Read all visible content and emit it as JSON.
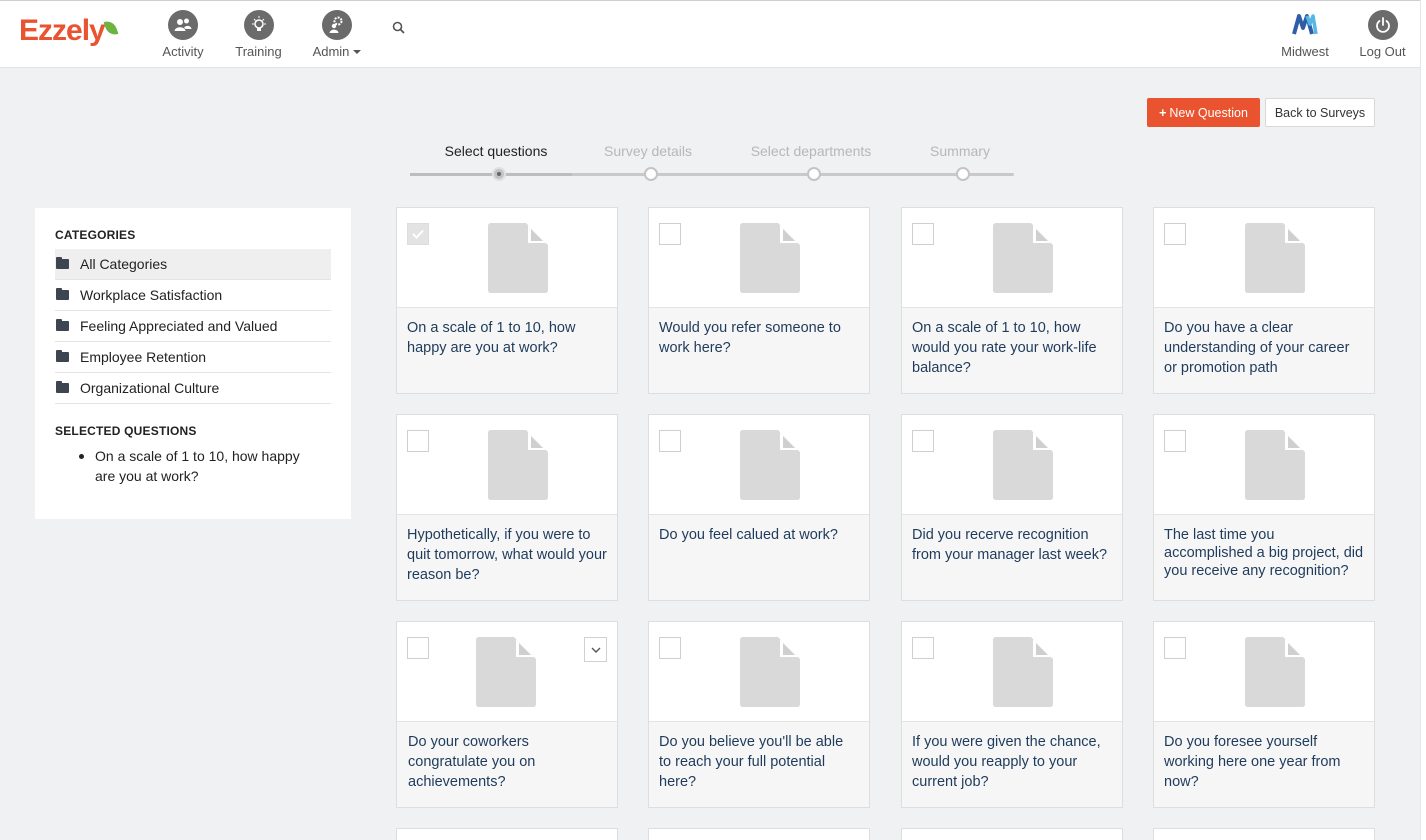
{
  "brand": {
    "logo_text": "Ezzely",
    "accent_color": "#e9532f"
  },
  "nav": {
    "items": [
      {
        "label": "Activity",
        "icon": "people-icon"
      },
      {
        "label": "Training",
        "icon": "lightbulb-icon"
      },
      {
        "label": "Admin",
        "icon": "admin-gear-icon"
      }
    ],
    "search_icon": "search-icon",
    "org": {
      "label": "Midwest",
      "icon": "midwest-logo-icon"
    },
    "logout": {
      "label": "Log Out",
      "icon": "power-icon"
    }
  },
  "actions": {
    "new_question": "New Question",
    "back_to_surveys": "Back to Surveys"
  },
  "stepper": {
    "steps": [
      "Select questions",
      "Survey details",
      "Select departments",
      "Summary"
    ],
    "active_index": 0
  },
  "sidebar": {
    "categories_heading": "CATEGORIES",
    "categories": [
      "All Categories",
      "Workplace Satisfaction",
      "Feeling Appreciated and Valued",
      "Employee Retention",
      "Organizational Culture"
    ],
    "active_category": 0,
    "selected_heading": "SELECTED QUESTIONS",
    "selected": [
      "On a scale of 1 to 10, how happy are you at work?"
    ]
  },
  "questions": [
    {
      "text": "On a scale of 1 to 10, how happy are you at work?",
      "checked": true
    },
    {
      "text": "Would you refer someone to work here?",
      "checked": false
    },
    {
      "text": "On a scale of 1 to 10, how would you rate your work-life balance?",
      "checked": false
    },
    {
      "text": "Do you have a clear understanding of your career or promotion path",
      "checked": false
    },
    {
      "text": "Hypothetically, if you were to quit tomorrow, what would your reason be?",
      "checked": false
    },
    {
      "text": "Do you feel calued at work?",
      "checked": false
    },
    {
      "text": "Did you recerve recognition from your manager last week?",
      "checked": false
    },
    {
      "text": "The last time you accomplished a big project, did you receive any recognition?",
      "checked": false
    },
    {
      "text": "Do your coworkers congratulate you on achievements?",
      "checked": false
    },
    {
      "text": "Do you believe you'll be able to reach your full potential here?",
      "checked": false
    },
    {
      "text": "If you were given the chance, would you reapply to your current job?",
      "checked": false
    },
    {
      "text": "Do you foresee yourself working here one year from now?",
      "checked": false
    }
  ]
}
